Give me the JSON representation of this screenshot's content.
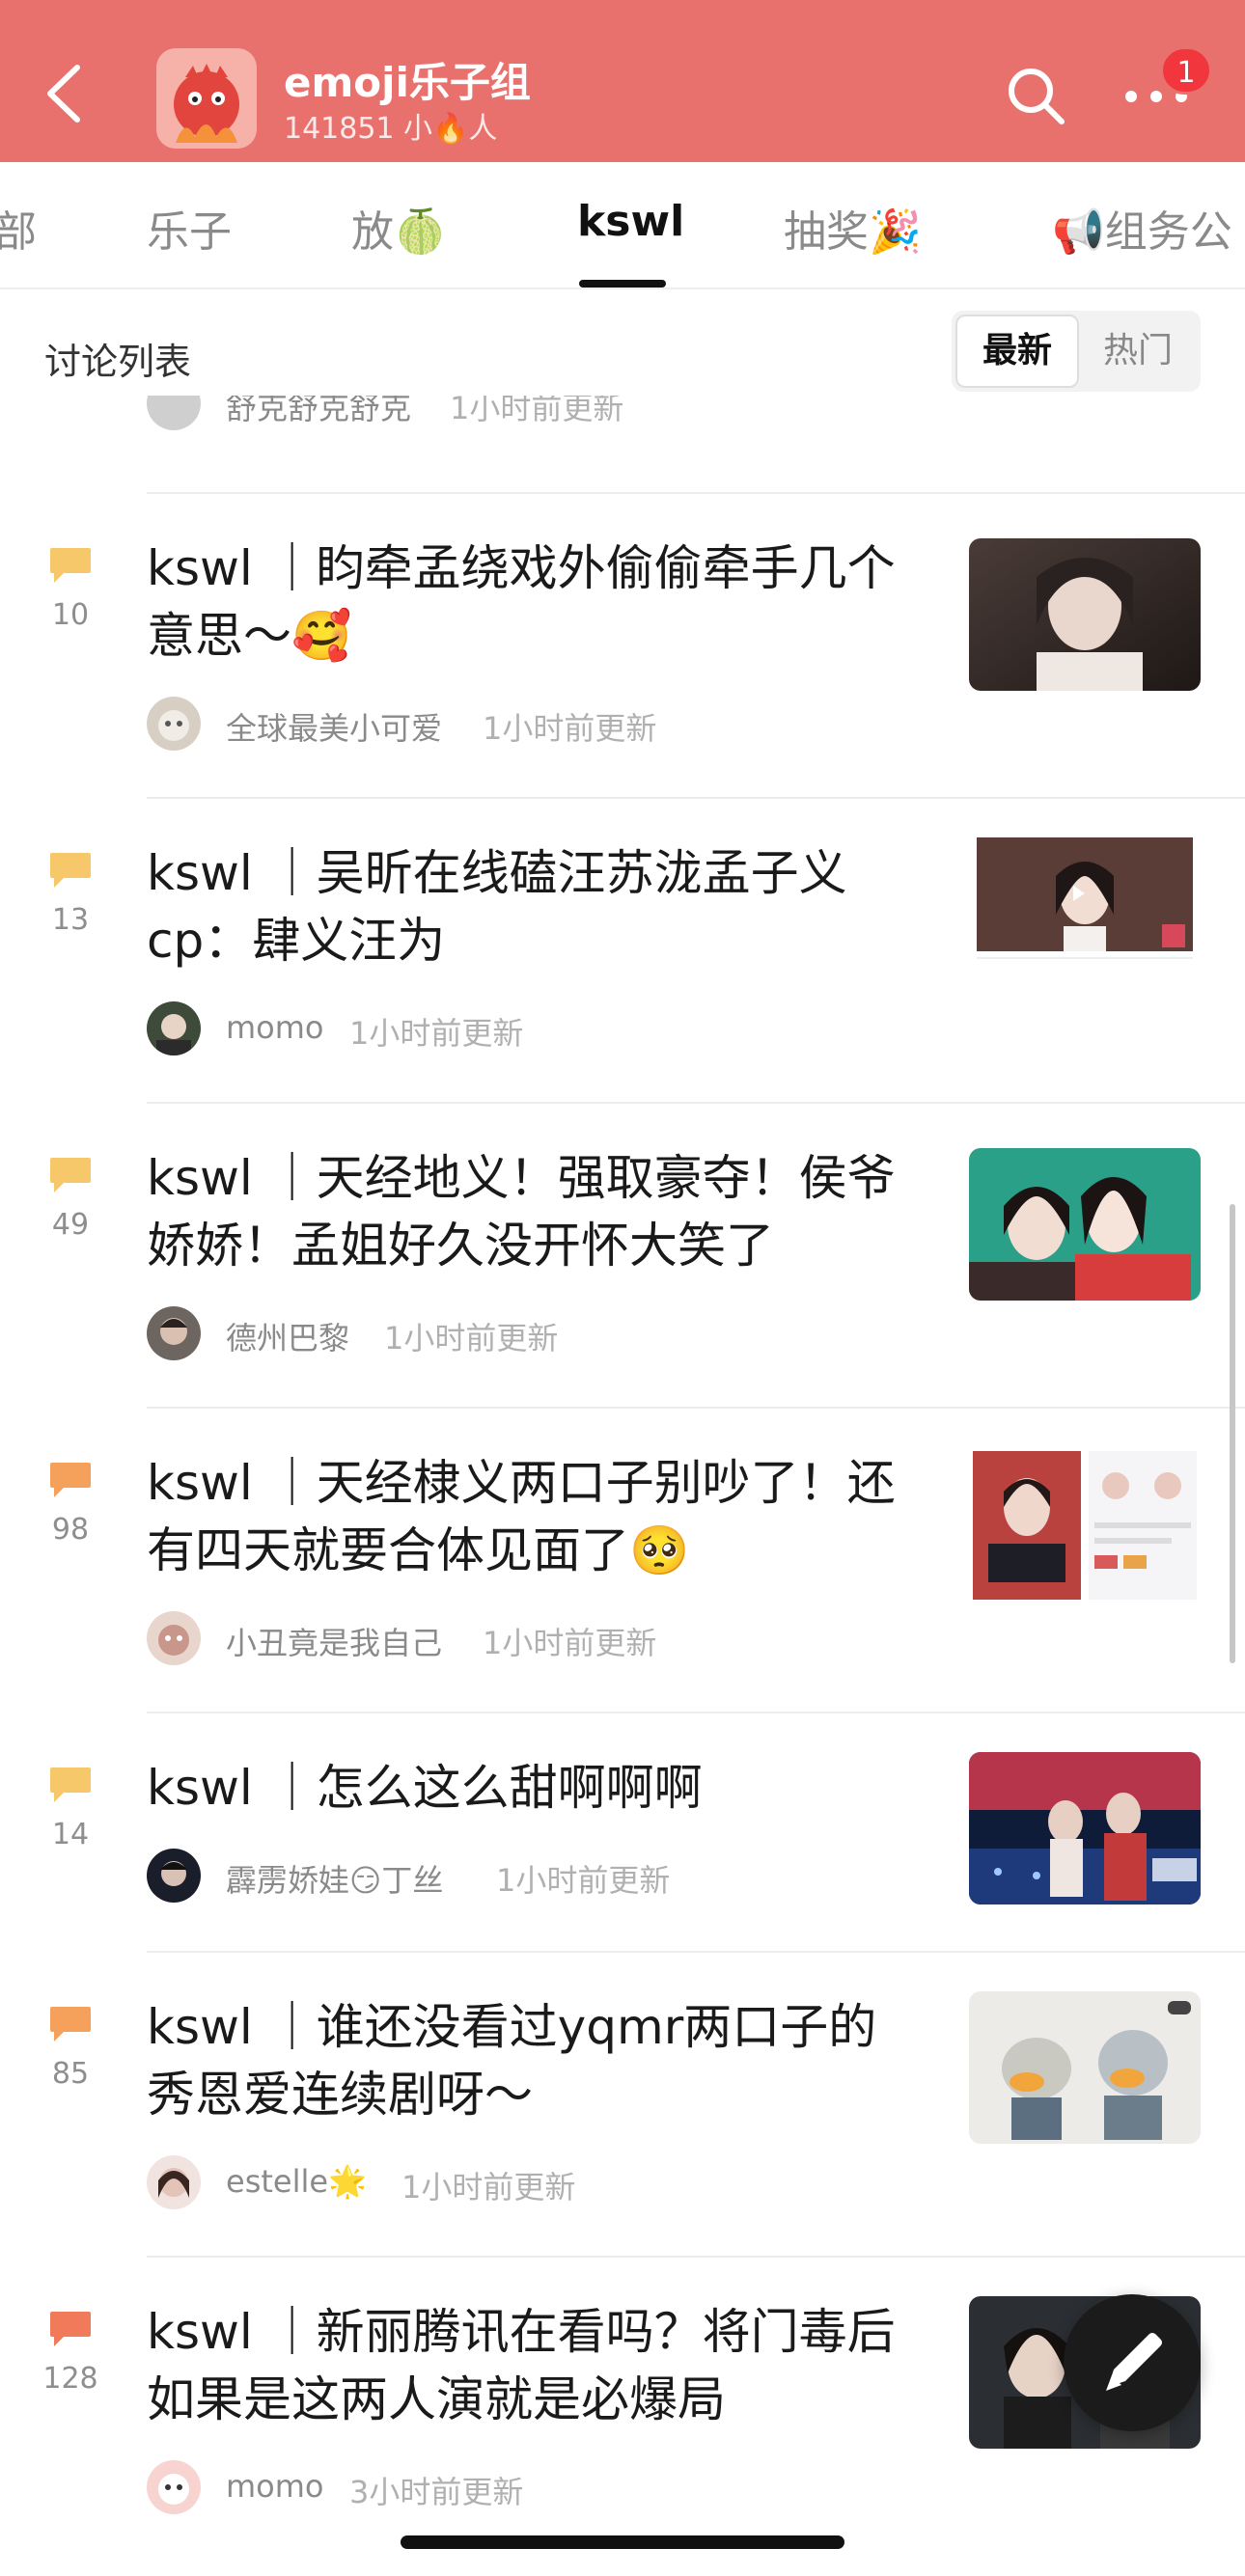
{
  "header": {
    "group_name": "emoji乐子组",
    "group_sub": "141851 小🔥人",
    "notification_count": "1",
    "bg_color": "#e8716e"
  },
  "tabs": [
    {
      "label": "部"
    },
    {
      "label": "乐子"
    },
    {
      "label": "放🍈"
    },
    {
      "label": "kswl"
    },
    {
      "label": "抽奖🎉"
    },
    {
      "label": "📢组务公"
    }
  ],
  "list": {
    "title": "讨论列表",
    "sort_latest": "最新",
    "sort_hot": "热门"
  },
  "partial_row": {
    "author": "舒克舒克舒克",
    "time": "1小时前更新"
  },
  "threads": [
    {
      "count": "10",
      "title": "kswl ｜盷牵孟绕戏外偷偷牵手几个意思～🥰",
      "author": "全球最美小可爱",
      "time": "1小时前更新",
      "icon_color": "#f7c86a"
    },
    {
      "count": "13",
      "title": "kswl ｜吴昕在线磕汪苏泷孟子义cp：肆义汪为",
      "author": "momo",
      "time": "1小时前更新",
      "icon_color": "#f7c86a"
    },
    {
      "count": "49",
      "title": "kswl ｜天经地义！强取豪夺！侯爷娇娇！孟姐好久没开怀大笑了",
      "author": "德州巴黎",
      "time": "1小时前更新",
      "icon_color": "#f7c86a"
    },
    {
      "count": "98",
      "title": "kswl ｜天经棣义两口子别吵了！还有四天就要合体见面了🥺",
      "author": "小丑竟是我自己",
      "time": "1小时前更新",
      "icon_color": "#f5a15c"
    },
    {
      "count": "14",
      "title": "kswl ｜怎么这么甜啊啊啊",
      "author": "霹雳娇娃😏丁丝",
      "time": "1小时前更新",
      "icon_color": "#f7c86a"
    },
    {
      "count": "85",
      "title": "kswl ｜谁还没看过yqmr两口子的秀恩爱连续剧呀～",
      "author": "estelle🌟",
      "time": "1小时前更新",
      "icon_color": "#f5a15c"
    },
    {
      "count": "128",
      "title": "kswl ｜新丽腾讯在看吗？将门毒后如果是这两人演就是必爆局",
      "author": "momo",
      "time": "3小时前更新",
      "icon_color": "#f07a5a"
    }
  ]
}
